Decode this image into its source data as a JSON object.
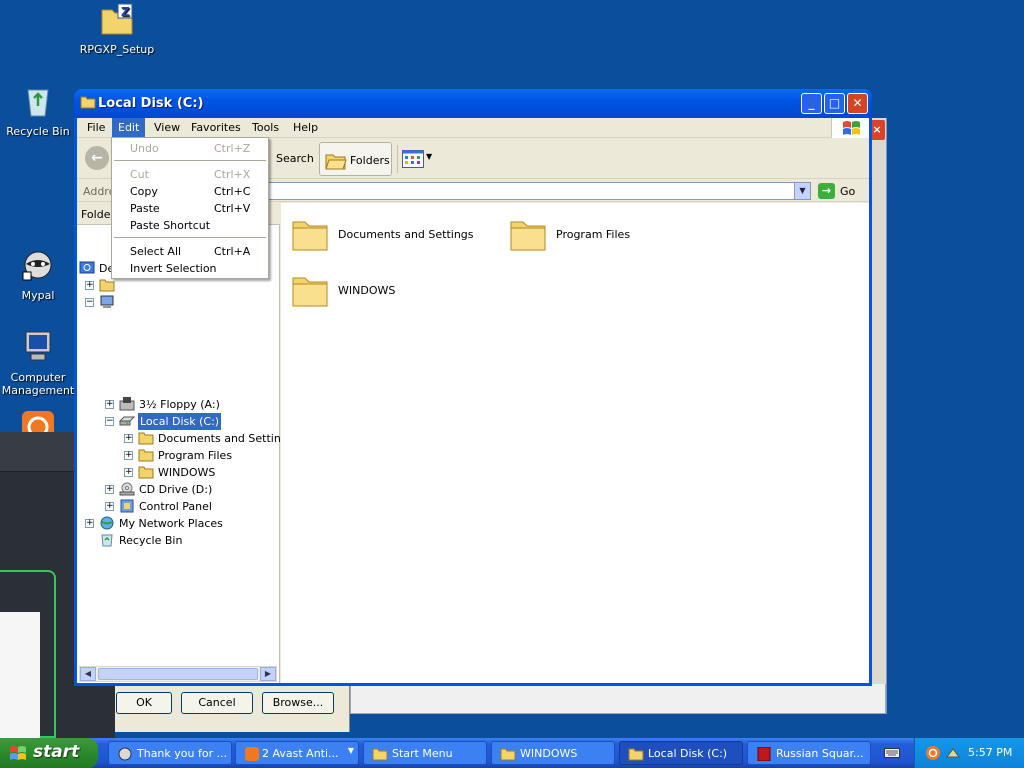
{
  "desktop": {
    "icons": [
      {
        "label": "RPGXP_Setup"
      },
      {
        "label": "Recycle Bin"
      },
      {
        "label": "Mypal"
      },
      {
        "label": "Computer Management"
      }
    ]
  },
  "window": {
    "title": "Local Disk (C:)",
    "menu": [
      "File",
      "Edit",
      "View",
      "Favorites",
      "Tools",
      "Help"
    ],
    "active_menu": "Edit",
    "toolbar": {
      "search_label": "Search",
      "folders_label": "Folders"
    },
    "address": {
      "label": "Addre",
      "value": "",
      "go_label": "Go"
    },
    "folders_pane_header": "Folde",
    "tree": [
      {
        "label": "De",
        "level": 0
      },
      {
        "label": "",
        "level": 1
      },
      {
        "label": "",
        "level": 1
      },
      {
        "label": "3½ Floppy (A:)",
        "level": 2
      },
      {
        "label": "Local Disk (C:)",
        "level": 2,
        "selected": true
      },
      {
        "label": "Documents and Settings",
        "level": 3
      },
      {
        "label": "Program Files",
        "level": 3
      },
      {
        "label": "WINDOWS",
        "level": 3
      },
      {
        "label": "CD Drive (D:)",
        "level": 2
      },
      {
        "label": "Control Panel",
        "level": 2
      },
      {
        "label": "My Network Places",
        "level": 1
      },
      {
        "label": "Recycle Bin",
        "level": 1
      }
    ],
    "content_items": [
      {
        "label": "Documents and Settings"
      },
      {
        "label": "Program Files"
      },
      {
        "label": "WINDOWS"
      }
    ]
  },
  "edit_menu": {
    "items": [
      {
        "label": "Undo",
        "shortcut": "Ctrl+Z",
        "enabled": false
      },
      {
        "label": "Cut",
        "shortcut": "Ctrl+X",
        "enabled": false
      },
      {
        "label": "Copy",
        "shortcut": "Ctrl+C",
        "enabled": true
      },
      {
        "label": "Paste",
        "shortcut": "Ctrl+V",
        "enabled": true
      },
      {
        "label": "Paste Shortcut",
        "shortcut": "",
        "enabled": true
      },
      {
        "label": "Select All",
        "shortcut": "Ctrl+A",
        "enabled": true
      },
      {
        "label": "Invert Selection",
        "shortcut": "",
        "enabled": true
      }
    ]
  },
  "background_dialog": {
    "buttons": [
      "OK",
      "Cancel",
      "Browse..."
    ]
  },
  "taskbar": {
    "start_label": "start",
    "buttons": [
      {
        "label": "Thank you for ..."
      },
      {
        "label": "2 Avast Anti..."
      },
      {
        "label": "Start Menu"
      },
      {
        "label": "WINDOWS"
      },
      {
        "label": "Local Disk (C:)"
      },
      {
        "label": "Russian Squar..."
      }
    ],
    "clock": "5:57 PM"
  },
  "colors": {
    "desktop": "#0a4e9c",
    "selection": "#316ac5",
    "title_bar": "#0054e3",
    "close_button": "#d44424"
  }
}
